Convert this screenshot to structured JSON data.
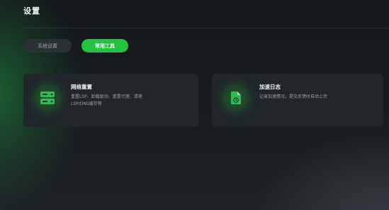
{
  "page": {
    "title": "设置"
  },
  "tabs": [
    {
      "label": "系统设置",
      "active": false
    },
    {
      "label": "常用工具",
      "active": true
    }
  ],
  "tools": [
    {
      "title": "网络重置",
      "description": "重置LSP、卸载驱动、重置代理、清理LSP/DNS缓存等",
      "icon": "server-icon"
    },
    {
      "title": "加速日志",
      "description": "记录加速情况，提交反馈时自动上传",
      "icon": "document-icon"
    }
  ],
  "colors": {
    "accent": "#24c240",
    "background": "#181c20",
    "card": "#20262a",
    "tab_inactive": "#2a3034"
  }
}
